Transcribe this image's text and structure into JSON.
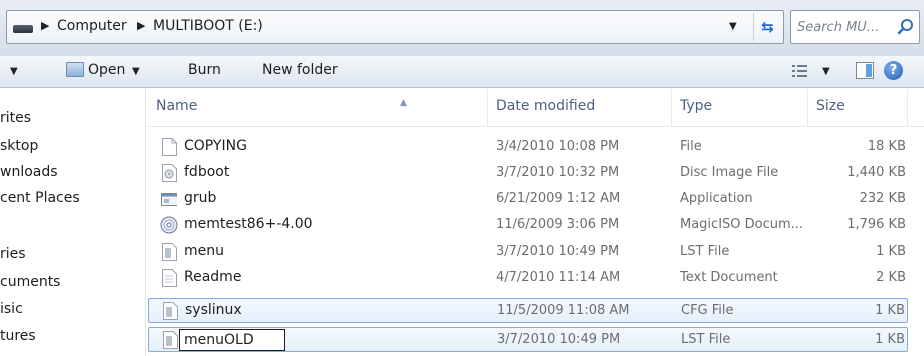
{
  "address": {
    "crumbs": [
      "Computer",
      "MULTIBOOT (E:)"
    ],
    "search_placeholder": "Search MU..."
  },
  "toolbar": {
    "open_label": "Open",
    "burn_label": "Burn",
    "new_folder_label": "New folder"
  },
  "nav": {
    "items": [
      "rites",
      "sktop",
      "wnloads",
      "cent Places",
      "ries",
      "cuments",
      "isic",
      "tures"
    ]
  },
  "columns": {
    "name": "Name",
    "date": "Date modified",
    "type": "Type",
    "size": "Size"
  },
  "files": [
    {
      "name": "COPYING",
      "date": "3/4/2010 10:08 PM",
      "type": "File",
      "size": "18 KB",
      "icon": "blank-file-icon"
    },
    {
      "name": "fdboot",
      "date": "3/7/2010 10:32 PM",
      "type": "Disc Image File",
      "size": "1,440 KB",
      "icon": "disc-image-file-icon"
    },
    {
      "name": "grub",
      "date": "6/21/2009 1:12 AM",
      "type": "Application",
      "size": "232 KB",
      "icon": "application-icon"
    },
    {
      "name": "memtest86+-4.00",
      "date": "11/6/2009 3:06 PM",
      "type": "MagicISO Docum...",
      "size": "1,796 KB",
      "icon": "cd-icon"
    },
    {
      "name": "menu",
      "date": "3/7/2010 10:49 PM",
      "type": "LST File",
      "size": "1 KB",
      "icon": "text-file-icon"
    },
    {
      "name": "Readme",
      "date": "4/7/2010 11:14 AM",
      "type": "Text Document",
      "size": "2 KB",
      "icon": "text-document-icon"
    },
    {
      "name": "syslinux",
      "date": "11/5/2009 11:08 AM",
      "type": "CFG File",
      "size": "1 KB",
      "icon": "config-file-icon"
    },
    {
      "name": "menuOLD",
      "date": "3/7/2010 10:49 PM",
      "type": "LST File",
      "size": "1 KB",
      "icon": "text-file-icon"
    }
  ],
  "colors": {
    "header_text": "#4d6185",
    "selection_border": "#84acdd",
    "link_blue": "#1c6ad1"
  }
}
